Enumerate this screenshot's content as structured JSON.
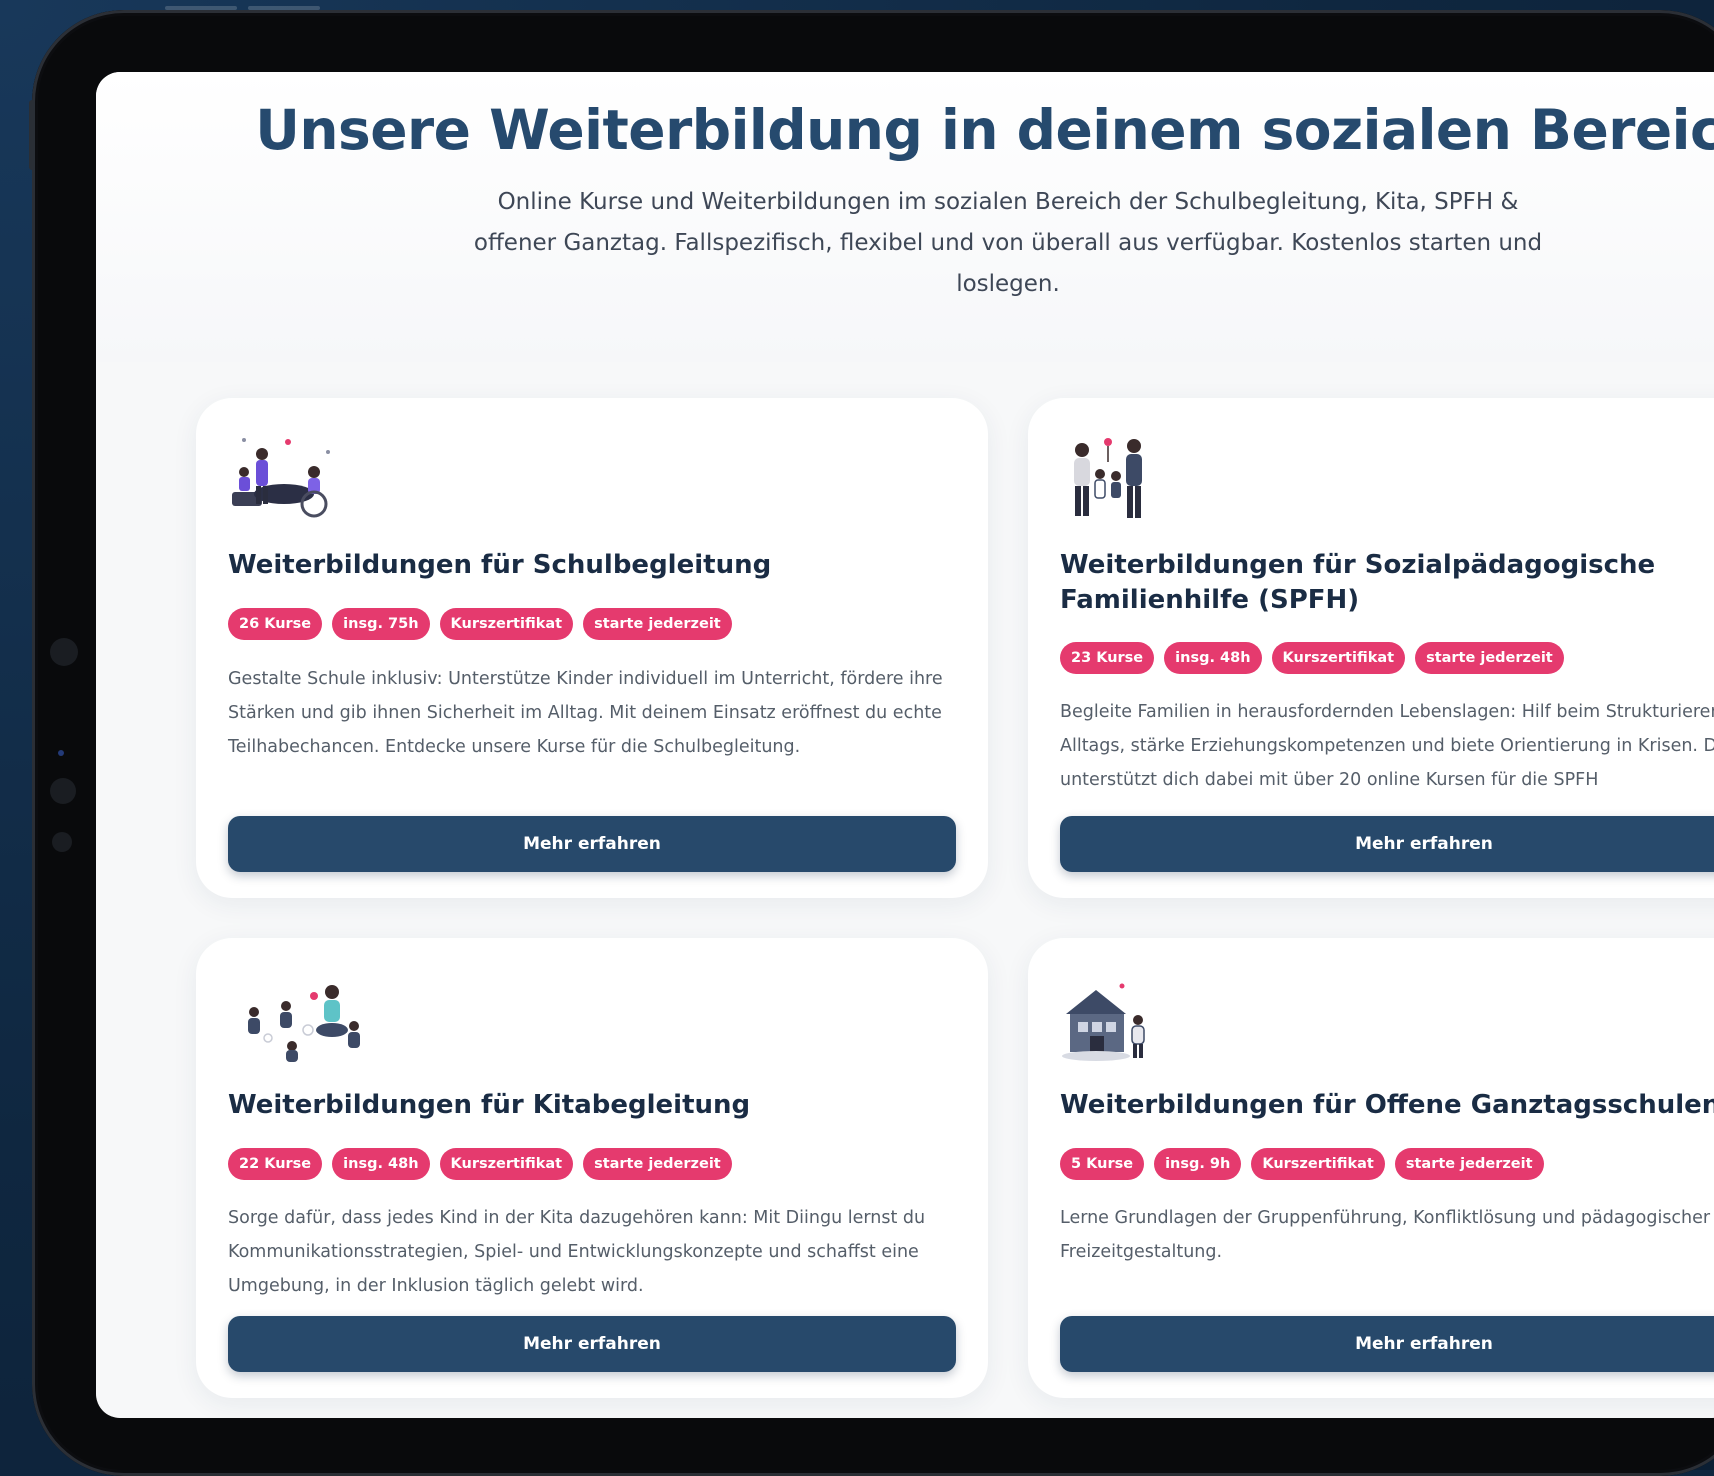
{
  "page": {
    "title": "Unsere Weiterbildung in deinem sozialen Bereich",
    "subtitle": "Online Kurse und Weiterbildungen im sozialen Bereich der Schulbegleitung, Kita, SPFH & offener Ganztag. Fallspezifisch, flexibel und von überall aus verfügbar. Kostenlos starten und loslegen."
  },
  "colors": {
    "headline": "#264a6e",
    "badge": "#e53a6e",
    "button": "#27496b",
    "background": "#0f2740"
  },
  "cards": [
    {
      "icon": "school-support-illustration-icon",
      "title": "Weiterbildungen für Schulbegleitung",
      "badges": [
        "26 Kurse",
        "insg. 75h",
        "Kurszertifikat",
        "starte jederzeit"
      ],
      "description": "Gestalte Schule inklusiv: Unterstütze Kinder individuell im Unterricht, fördere ihre Stärken und gib ihnen Sicherheit im Alltag. Mit deinem Einsatz eröffnest du echte Teilhabechancen. Entdecke unsere Kurse für die Schulbegleitung.",
      "button": "Mehr erfahren"
    },
    {
      "icon": "family-illustration-icon",
      "title": "Weiterbildungen für Sozialpädagogische Familienhilfe (SPFH)",
      "badges": [
        "23 Kurse",
        "insg. 48h",
        "Kurszertifikat",
        "starte jederzeit"
      ],
      "description": "Begleite Familien in herausfordernden Lebenslagen: Hilf beim Strukturieren des Alltags, stärke Erziehungskompetenzen und biete Orientierung in Krisen. Diingu unterstützt dich dabei mit über 20 online Kursen für die SPFH",
      "button": "Mehr erfahren"
    },
    {
      "icon": "kita-illustration-icon",
      "title": "Weiterbildungen für Kitabegleitung",
      "badges": [
        "22 Kurse",
        "insg. 48h",
        "Kurszertifikat",
        "starte jederzeit"
      ],
      "description": "Sorge dafür, dass jedes Kind in der Kita dazugehören kann: Mit Diingu lernst du Kommunikationsstrategien, Spiel- und Entwicklungskonzepte und schaffst eine Umgebung, in der Inklusion täglich gelebt wird.",
      "button": "Mehr erfahren"
    },
    {
      "icon": "school-building-illustration-icon",
      "title": "Weiterbildungen für Offene Ganztagsschulen (OGS)",
      "badges": [
        "5 Kurse",
        "insg. 9h",
        "Kurszertifikat",
        "starte jederzeit"
      ],
      "description": "Lerne Grundlagen der Gruppenführung, Konfliktlösung und pädagogischer Freizeitgestaltung.",
      "button": "Mehr erfahren"
    }
  ]
}
